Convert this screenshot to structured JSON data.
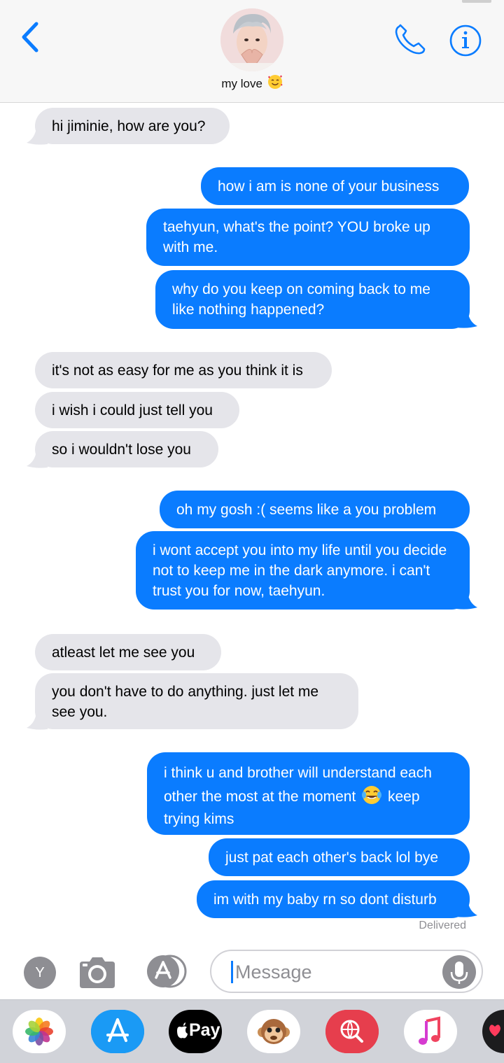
{
  "header": {
    "contact_name": "my love",
    "name_emoji": "smiling-face-with-hearts"
  },
  "messages": [
    {
      "side": "in",
      "text": "hi jiminie, how are you?"
    },
    {
      "side": "out",
      "text": "how i am is none of your business"
    },
    {
      "side": "out",
      "text": "taehyun, what's the point? YOU broke up with me."
    },
    {
      "side": "out",
      "text": "why do you keep on coming back to me like nothing happened?"
    },
    {
      "side": "in",
      "text": "it's not as easy for me as you think it is"
    },
    {
      "side": "in",
      "text": "i wish i could just tell you"
    },
    {
      "side": "in",
      "text": "so i wouldn't lose you"
    },
    {
      "side": "out",
      "text": "oh my gosh :( seems like a you problem"
    },
    {
      "side": "out",
      "text": "i wont accept you into my life until you decide not to keep me in the dark anymore. i can't trust you for now, taehyun."
    },
    {
      "side": "in",
      "text": "atleast let me see you"
    },
    {
      "side": "in",
      "text": "you don't have to do anything. just let me see you."
    },
    {
      "side": "out",
      "text_before_emoji": "i think u and brother will understand each other the most at the moment",
      "emoji": "face-with-tears-of-joy",
      "text_after_emoji": "keep trying kims"
    },
    {
      "side": "out",
      "text": "just pat each other's back lol bye"
    },
    {
      "side": "out",
      "text": "im with my baby rn so dont disturb"
    }
  ],
  "status": {
    "delivered": "Delivered"
  },
  "input_bar": {
    "avatar_letter": "Y",
    "placeholder": "Message"
  },
  "app_drawer": {
    "apple_pay_label": "Pay",
    "apps": [
      "photos-icon",
      "app-store-icon",
      "apple-pay-icon",
      "animoji-icon",
      "web-images-search-icon",
      "music-icon",
      "digital-touch-icon"
    ]
  },
  "colors": {
    "outgoing_bubble": "#0a7cff",
    "incoming_bubble": "#e5e5ea",
    "accent": "#0a7cff",
    "drawer_bg": "#d1d3d9"
  }
}
